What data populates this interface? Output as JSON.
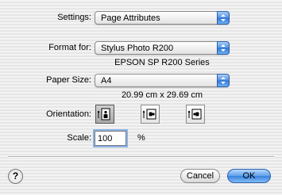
{
  "settings": {
    "label": "Settings:",
    "value": "Page Attributes"
  },
  "format_for": {
    "label": "Format for:",
    "value": "Stylus Photo R200",
    "description": "EPSON SP R200 Series"
  },
  "paper_size": {
    "label": "Paper Size:",
    "value": "A4",
    "dimensions": "20.99 cm x 29.69 cm"
  },
  "orientation": {
    "label": "Orientation:",
    "selected": "portrait"
  },
  "scale": {
    "label": "Scale:",
    "value": "100",
    "unit": "%"
  },
  "help": {
    "symbol": "?"
  },
  "buttons": {
    "cancel": "Cancel",
    "ok": "OK"
  },
  "colors": {
    "accent": "#3a82e0"
  }
}
